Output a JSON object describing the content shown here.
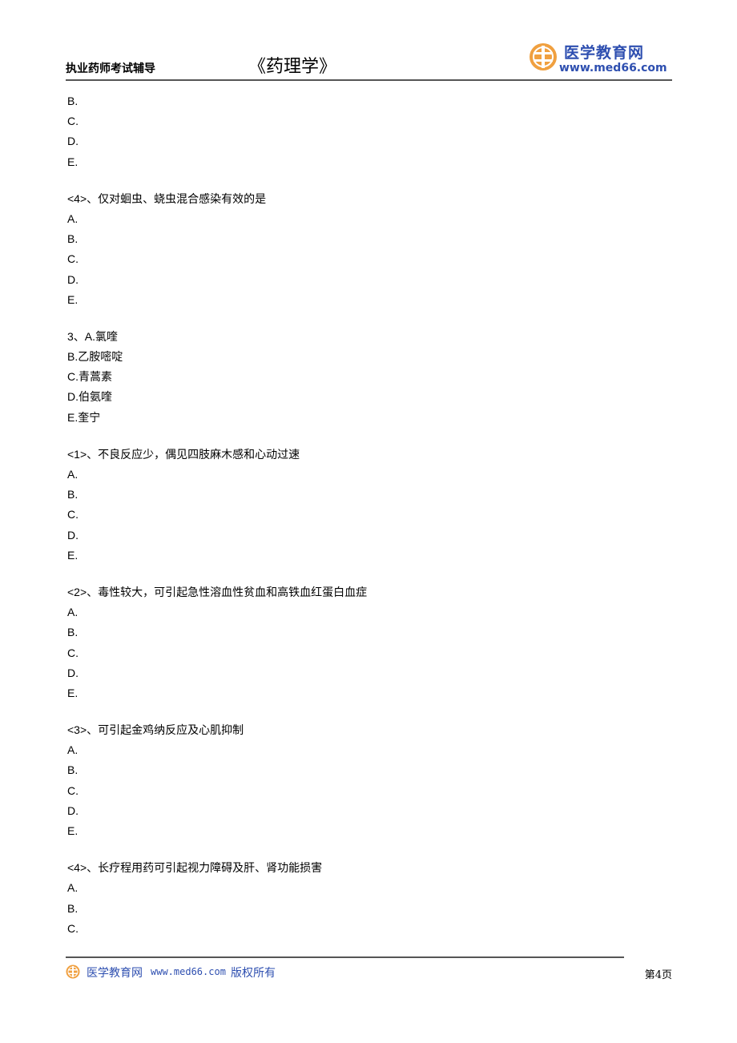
{
  "header": {
    "subtitle": "执业药师考试辅导",
    "title": "《药理学》",
    "logo_name": "医学教育网",
    "logo_url": "www.med66.com",
    "brand_color": "#2e4fb0",
    "logo_color": "#f0a040"
  },
  "content": {
    "lines": [
      "B.",
      "C.",
      "D.",
      "E.",
      "",
      "<4>、仅对蛔虫、蛲虫混合感染有效的是",
      "A.",
      "B.",
      "C.",
      "D.",
      "E.",
      "",
      "3、A.氯喹",
      "B.乙胺嘧啶",
      "C.青蒿素",
      "D.伯氨喹",
      "E.奎宁",
      "",
      "<1>、不良反应少，偶见四肢麻木感和心动过速",
      "A.",
      "B.",
      "C.",
      "D.",
      "E.",
      "",
      "<2>、毒性较大，可引起急性溶血性贫血和高铁血红蛋白血症",
      "A.",
      "B.",
      "C.",
      "D.",
      "E.",
      "",
      "<3>、可引起金鸡纳反应及心肌抑制",
      "A.",
      "B.",
      "C.",
      "D.",
      "E.",
      "",
      "<4>、长疗程用药可引起视力障碍及肝、肾功能损害",
      "A.",
      "B.",
      "C."
    ]
  },
  "footer": {
    "brand": "医学教育网",
    "url": "www.med66.com",
    "rights": "版权所有",
    "page": "第4页"
  }
}
